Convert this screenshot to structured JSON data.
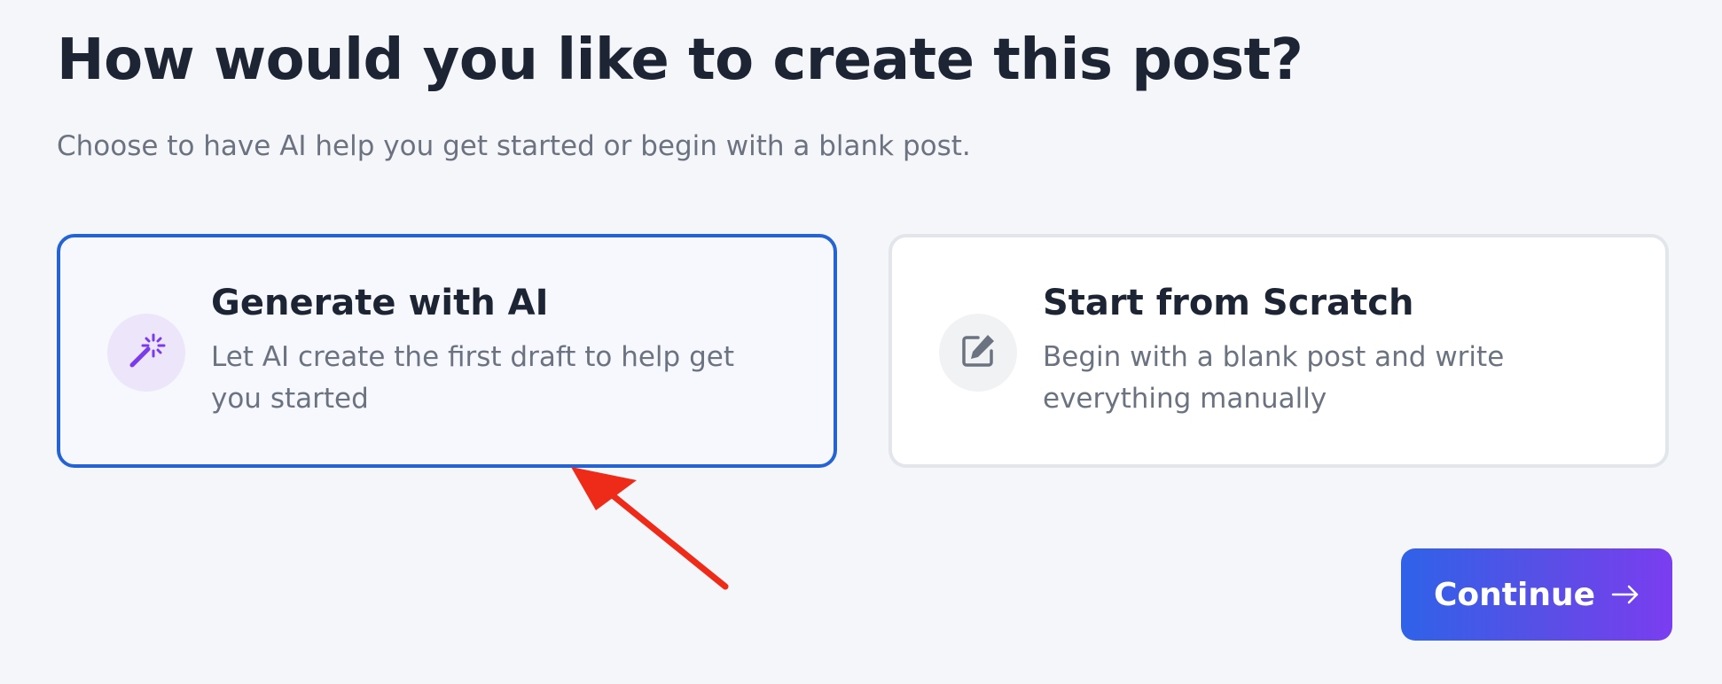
{
  "header": {
    "title": "How would you like to create this post?",
    "subtitle": "Choose to have AI help you get started or begin with a blank post."
  },
  "options": [
    {
      "title": "Generate with AI",
      "description": "Let AI create the first draft to help get you started",
      "icon": "magic-wand-icon",
      "selected": true
    },
    {
      "title": "Start from Scratch",
      "description": "Begin with a blank post and write everything manually",
      "icon": "edit-icon",
      "selected": false
    }
  ],
  "actions": {
    "continue_label": "Continue",
    "continue_icon": "arrow-right-icon"
  },
  "colors": {
    "accent": "#2563d4",
    "gradient_start": "#2f62e8",
    "gradient_end": "#7a3df0",
    "annotation": "#ee2a18"
  }
}
